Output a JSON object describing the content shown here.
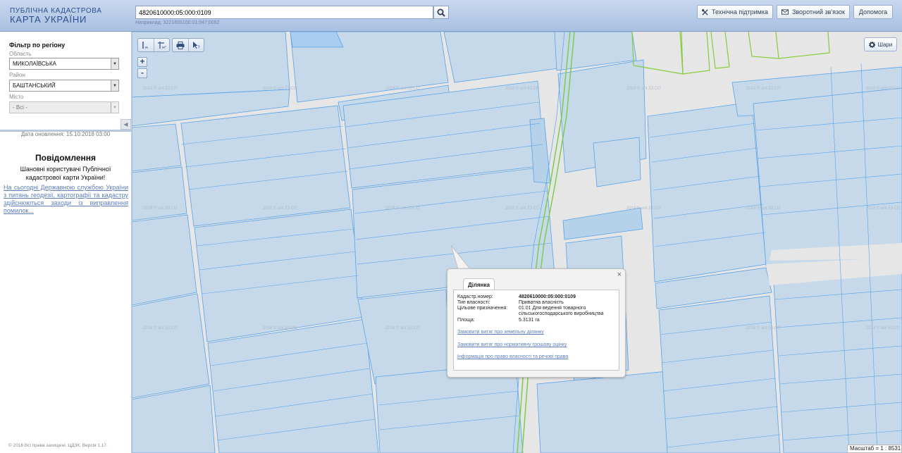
{
  "header": {
    "logo_line1": "ПУБЛІЧНА КАДАСТРОВА",
    "logo_line2": "КАРТА УКРАЇНИ",
    "search_value": "4820610000:05:000:0109",
    "search_hint": "Наприклад: 3221655100:01:047:0052",
    "buttons": {
      "support": "Технічна підтримка",
      "feedback": "Зворотний зв'язок",
      "help": "Допомога"
    }
  },
  "sidebar": {
    "filter_title": "Фільтр по регіону",
    "region_label": "Область",
    "region_value": "МИКОЛАЇВСЬКА",
    "district_label": "Район",
    "district_value": "БАШТАНСЬКИЙ",
    "city_label": "Місто",
    "city_value": "- Всі -",
    "update_date": "Дата оновлення: 15.10.2018 03:00",
    "notice_title": "Повідомлення",
    "notice_body": "Шановні користувачі Публічної кадастрової карти України!",
    "notice_link": "На сьогодні Державною службою України з питань геодезії, картографії та кадастру здійснюються заходи із виправлення помилок...",
    "copyright": "© 2016 Всі права захищені. ЦДЗК. Версія 1.17."
  },
  "map": {
    "layers_label": "Шари",
    "zoom_in": "+",
    "zoom_out": "-",
    "watermark": "2018 © ant.53.CO",
    "scale_text": "Масштаб = 1 : 8531",
    "colors": {
      "parcel_fill": "#c6d9ea",
      "parcel_stroke": "#5aa2e6",
      "road_green": "#7ccd4d",
      "base": "#e6e6e6"
    }
  },
  "popup": {
    "tab": "Ділянка",
    "close": "×",
    "fields": [
      {
        "key": "Кадастр.номер:",
        "value": "4820610000:05:000:0109",
        "bold": true
      },
      {
        "key": "Тип власності:",
        "value": "Приватна власність",
        "bold": false
      },
      {
        "key": "Цільове призначення:",
        "value": "01.01 Для ведення товарного сільськогосподарського виробництва",
        "bold": false
      },
      {
        "key": "Площа:",
        "value": "5.3131 га",
        "bold": false
      }
    ],
    "links": [
      "Замовити витяг про земельну ділянку",
      "Замовити витяг про нормативну грошову оцінку",
      "Інформація про право власності та речові права"
    ]
  }
}
